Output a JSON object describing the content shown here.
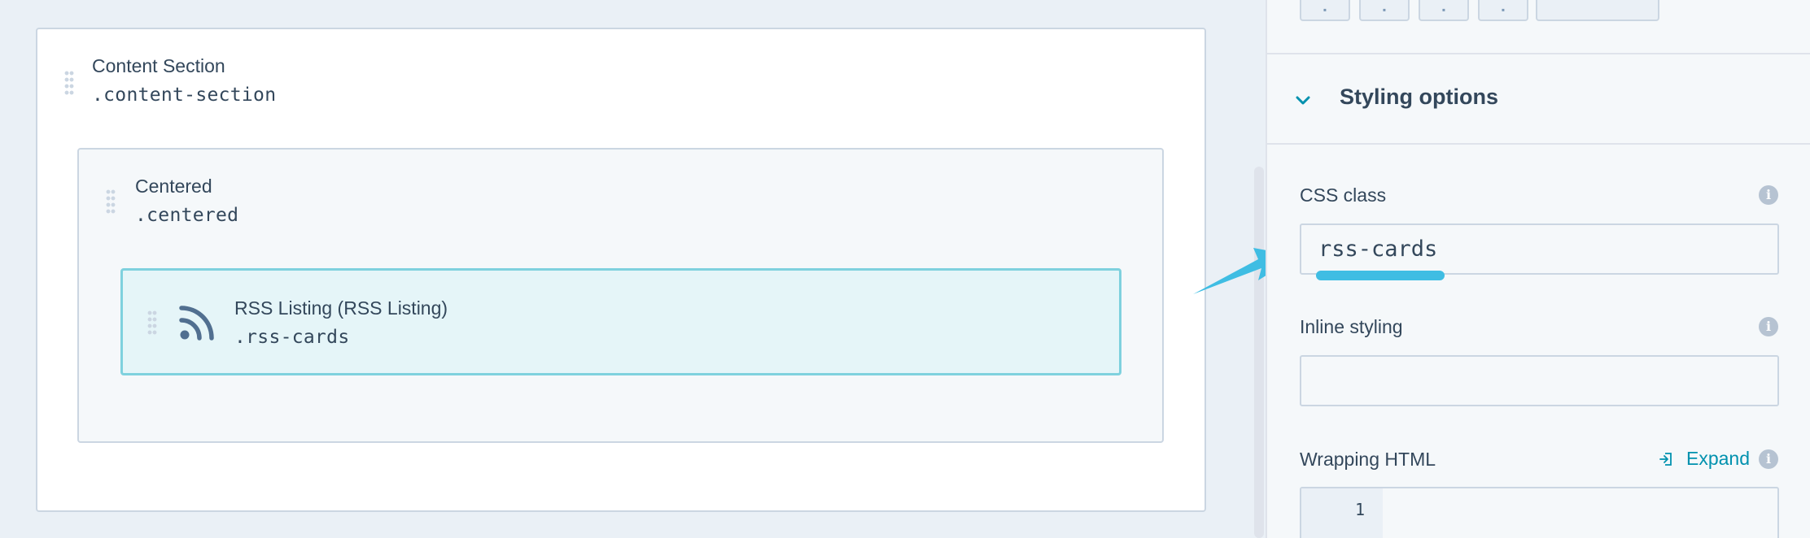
{
  "canvas": {
    "section": {
      "title": "Content Section",
      "class_name": ".content-section"
    },
    "centered": {
      "title": "Centered",
      "class_name": ".centered"
    },
    "rss": {
      "title": "RSS Listing (RSS Listing)",
      "class_name": ".rss-cards",
      "icon": "rss-icon"
    }
  },
  "panel": {
    "toolbar_icons": [
      "toolbar-icon-1",
      "toolbar-icon-2",
      "toolbar-icon-3",
      "toolbar-icon-4",
      "toolbar-button-wide"
    ],
    "styling_options": {
      "title": "Styling options",
      "icon": "chevron-down-icon",
      "expanded": true
    },
    "css_class": {
      "label": "CSS class",
      "value": "rss-cards"
    },
    "inline_styling": {
      "label": "Inline styling",
      "value": ""
    },
    "wrapping_html": {
      "label": "Wrapping HTML",
      "expand_label": "Expand",
      "line_numbers": [
        "1"
      ]
    }
  },
  "colors": {
    "accent": "#0091ae",
    "selected_module_bg": "#e5f5f8",
    "selected_module_border": "#7fd1de",
    "annotation_blue": "#3fbde3"
  }
}
